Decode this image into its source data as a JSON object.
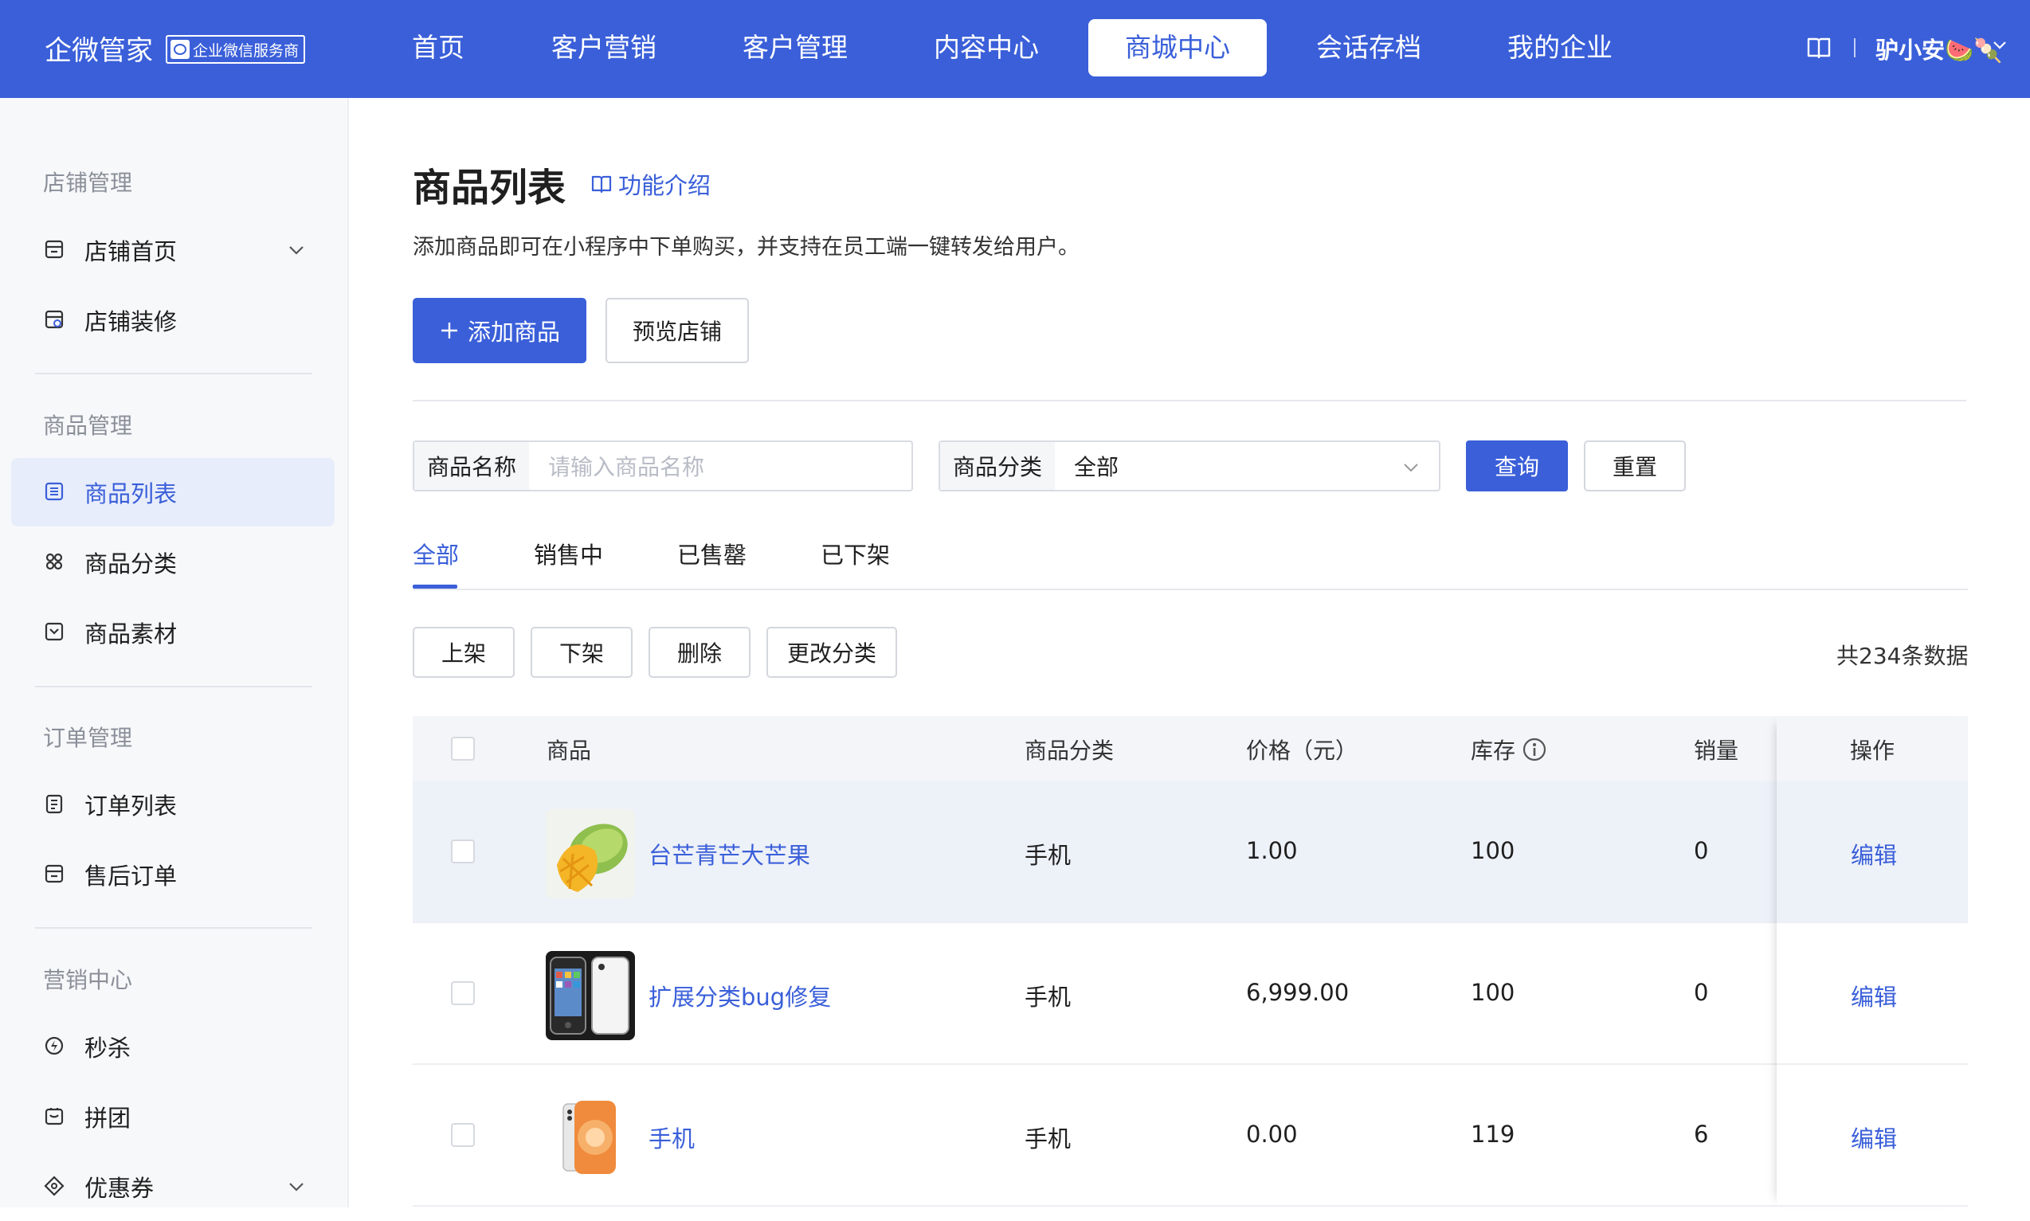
{
  "header": {
    "logo": "企微管家",
    "badge": "企业微信服务商",
    "nav": [
      "首页",
      "客户营销",
      "客户管理",
      "内容中心",
      "商城中心",
      "会话存档",
      "我的企业"
    ],
    "active_nav": "商城中心",
    "user": "驴小安🍉🍡"
  },
  "sidebar": {
    "sections": [
      {
        "title": "店铺管理",
        "items": [
          {
            "label": "店铺首页",
            "icon": "store-icon",
            "has_chevron": true
          },
          {
            "label": "店铺装修",
            "icon": "store-decorate-icon"
          }
        ]
      },
      {
        "title": "商品管理",
        "items": [
          {
            "label": "商品列表",
            "icon": "list-icon",
            "active": true
          },
          {
            "label": "商品分类",
            "icon": "category-icon"
          },
          {
            "label": "商品素材",
            "icon": "material-icon"
          }
        ]
      },
      {
        "title": "订单管理",
        "items": [
          {
            "label": "订单列表",
            "icon": "order-icon"
          },
          {
            "label": "售后订单",
            "icon": "after-sales-icon"
          }
        ]
      },
      {
        "title": "营销中心",
        "items": [
          {
            "label": "秒杀",
            "icon": "flash-sale-icon"
          },
          {
            "label": "拼团",
            "icon": "group-buy-icon"
          },
          {
            "label": "优惠券",
            "icon": "coupon-icon",
            "has_chevron": true
          }
        ]
      }
    ]
  },
  "page": {
    "title": "商品列表",
    "intro_link": "功能介绍",
    "subtitle": "添加商品即可在小程序中下单购买，并支持在员工端一键转发给用户。",
    "add_button": "添加商品",
    "preview_button": "预览店铺"
  },
  "filters": {
    "name_label": "商品名称",
    "name_placeholder": "请输入商品名称",
    "category_label": "商品分类",
    "category_value": "全部",
    "query": "查询",
    "reset": "重置"
  },
  "tabs": [
    "全部",
    "销售中",
    "已售罄",
    "已下架"
  ],
  "active_tab": "全部",
  "bulk_actions": [
    "上架",
    "下架",
    "删除",
    "更改分类"
  ],
  "total": "共234条数据",
  "table": {
    "columns": [
      "商品",
      "商品分类",
      "价格（元）",
      "库存",
      "销量",
      "操作"
    ],
    "rows": [
      {
        "name": "台芒青芒大芒果",
        "category": "手机",
        "price": "1.00",
        "stock": "100",
        "sales": "0",
        "action": "编辑",
        "image": "mango"
      },
      {
        "name": "扩展分类bug修复",
        "category": "手机",
        "price": "6,999.00",
        "stock": "100",
        "sales": "0",
        "action": "编辑",
        "image": "phone-black"
      },
      {
        "name": "手机",
        "category": "手机",
        "price": "0.00",
        "stock": "119",
        "sales": "6",
        "action": "编辑",
        "image": "phone-white"
      }
    ]
  },
  "colors": {
    "brand": "#3a5fd9"
  }
}
